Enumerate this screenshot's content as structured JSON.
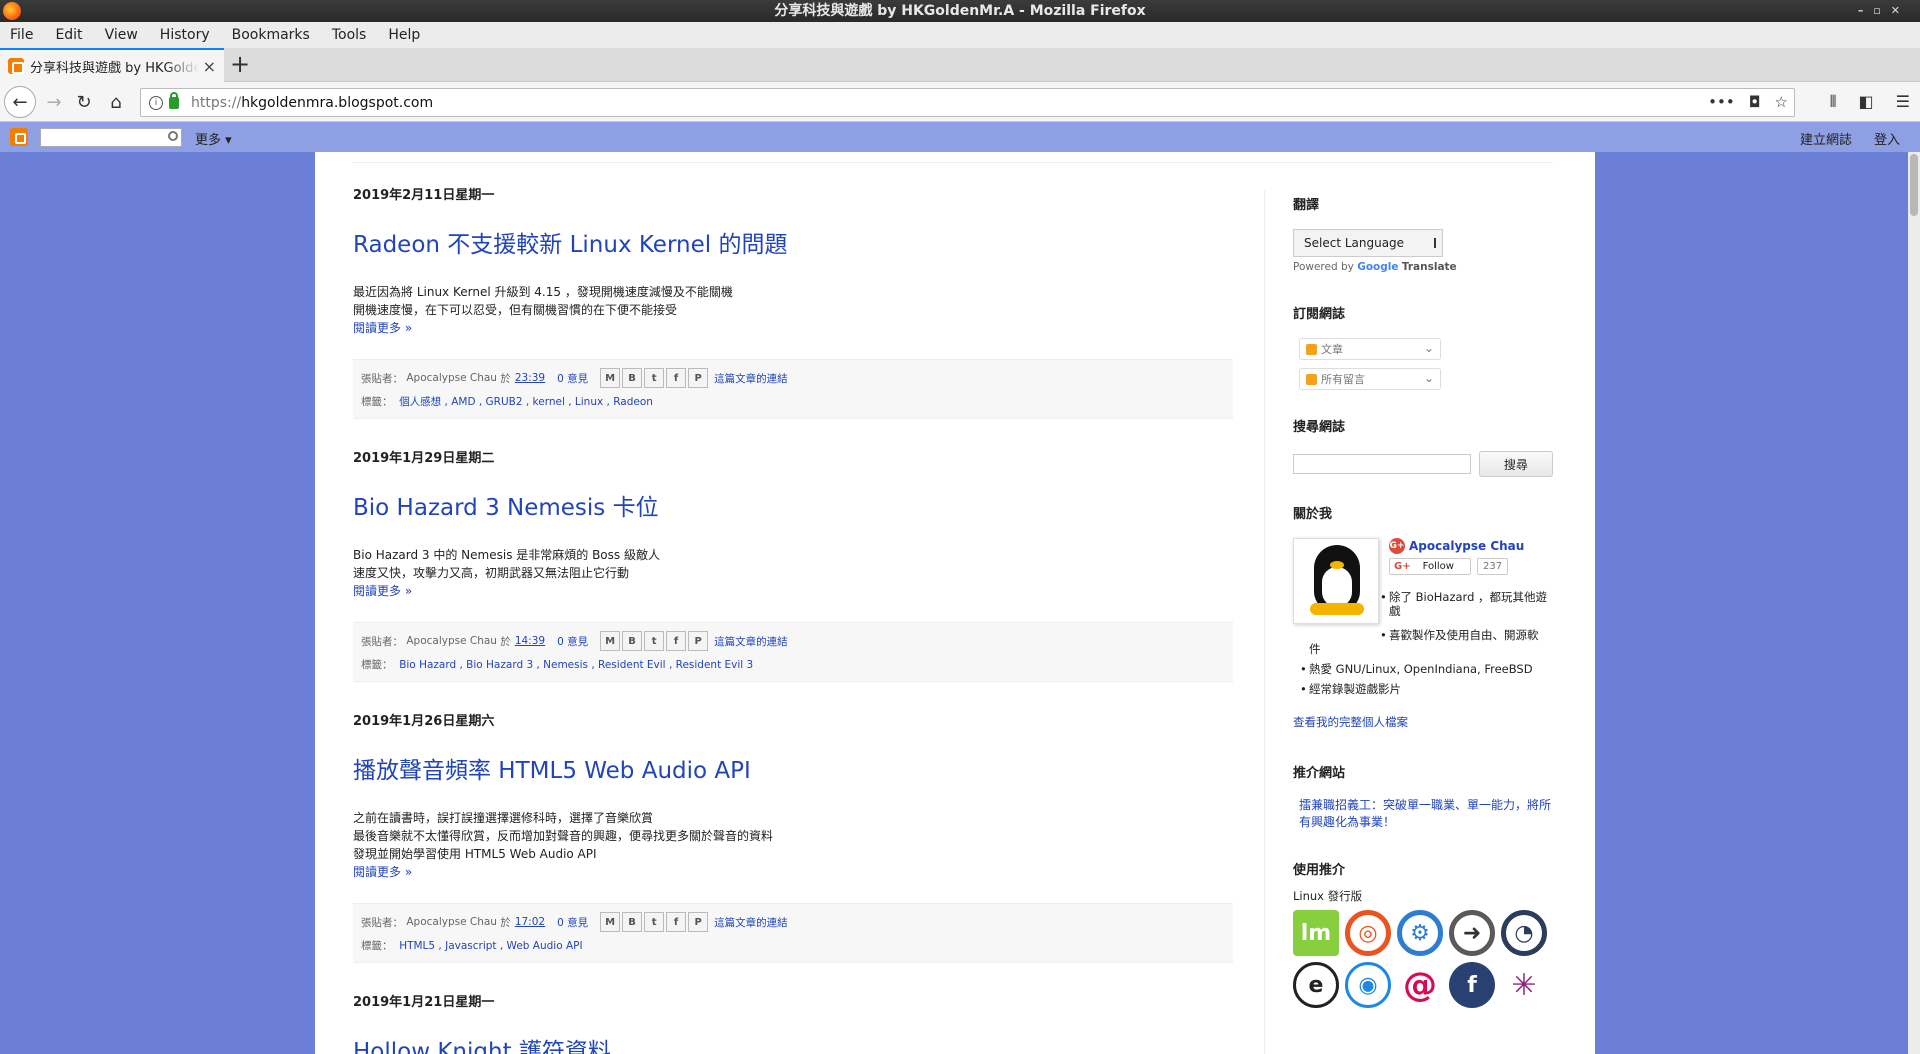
{
  "window": {
    "title": "分享科技與遊戲 by HKGoldenMr.A - Mozilla Firefox"
  },
  "menu": [
    "File",
    "Edit",
    "View",
    "History",
    "Bookmarks",
    "Tools",
    "Help"
  ],
  "tab": {
    "title": "分享科技與遊戲 by HKGoldenMr.A"
  },
  "url": {
    "protocol": "https://",
    "host": "hkgoldenmra.blogspot.com"
  },
  "blogger": {
    "more": "更多 ▾",
    "create": "建立網誌",
    "login": "登入"
  },
  "posts": [
    {
      "date": "2019年2月11日星期一",
      "title": "Radeon 不支援較新 Linux Kernel 的問題",
      "lines": [
        "最近因為將 Linux Kernel 升級到 4.15 ，發現開機速度減慢及不能關機",
        "開機速度慢，在下可以忍受，但有關機習慣的在下便不能接受"
      ],
      "readmore": "閱讀更多 »",
      "author_prefix": "張貼者：",
      "author": "Apocalypse Chau",
      "at": "於",
      "time": "23:39",
      "comments": "0 意見",
      "link": "這篇文章的連結",
      "labels_prefix": "標籤：",
      "labels": "個人感想 , AMD , GRUB2 , kernel , Linux , Radeon"
    },
    {
      "date": "2019年1月29日星期二",
      "title": "Bio Hazard 3 Nemesis 卡位",
      "lines": [
        "Bio Hazard 3 中的 Nemesis 是非常麻煩的 Boss 級敵人",
        "速度又快，攻擊力又高，初期武器又無法阻止它行動"
      ],
      "readmore": "閱讀更多 »",
      "author_prefix": "張貼者：",
      "author": "Apocalypse Chau",
      "at": "於",
      "time": "14:39",
      "comments": "0 意見",
      "link": "這篇文章的連結",
      "labels_prefix": "標籤：",
      "labels": "Bio Hazard , Bio Hazard 3 , Nemesis , Resident Evil , Resident Evil 3"
    },
    {
      "date": "2019年1月26日星期六",
      "title": "播放聲音頻率 HTML5 Web Audio API",
      "lines": [
        "之前在讀書時，誤打誤撞選擇選修科時，選擇了音樂欣賞",
        "最後音樂就不太懂得欣賞，反而增加對聲音的興趣，便尋找更多關於聲音的資料",
        "發現並開始學習使用 HTML5 Web Audio API"
      ],
      "readmore": "閱讀更多 »",
      "author_prefix": "張貼者：",
      "author": "Apocalypse Chau",
      "at": "於",
      "time": "17:02",
      "comments": "0 意見",
      "link": "這篇文章的連結",
      "labels_prefix": "標籤：",
      "labels": "HTML5 , Javascript , Web Audio API"
    },
    {
      "date": "2019年1月21日星期一",
      "title": "Hollow Knight 護符資料"
    }
  ],
  "share_icons": [
    "M",
    "B",
    "t",
    "f",
    "P"
  ],
  "sidebar": {
    "translate": {
      "title": "翻譯",
      "select": "Select Language",
      "powered": "Powered by",
      "google": "Google",
      "translate": "Translate"
    },
    "subscribe": {
      "title": "訂閱網誌",
      "posts": "文章",
      "comments": "所有留言"
    },
    "search": {
      "title": "搜尋網誌",
      "button": "搜尋"
    },
    "about": {
      "title": "關於我",
      "name": "Apocalypse Chau",
      "follow": "Follow",
      "followers": "237",
      "items": [
        "除了 BioHazard ，都玩其他遊戲",
        "喜歡製作及使用自由、開源軟",
        "件",
        "熱愛 GNU/Linux, OpenIndiana, FreeBSD",
        "經常錄製遊戲影片"
      ],
      "profile_link": "查看我的完整個人檔案"
    },
    "recommend": {
      "title": "推介網站",
      "link": "擂兼職招義工：突破單一職業、單一能力，將所有興趣化為事業！"
    },
    "usage": {
      "title": "使用推介",
      "linux_label": "Linux 發行版"
    }
  },
  "colors": {
    "page_bg": "#6b7fd6",
    "link": "#2244bb",
    "blogger_orange": "#f57d00",
    "tab_accent": "#0a84ff"
  }
}
